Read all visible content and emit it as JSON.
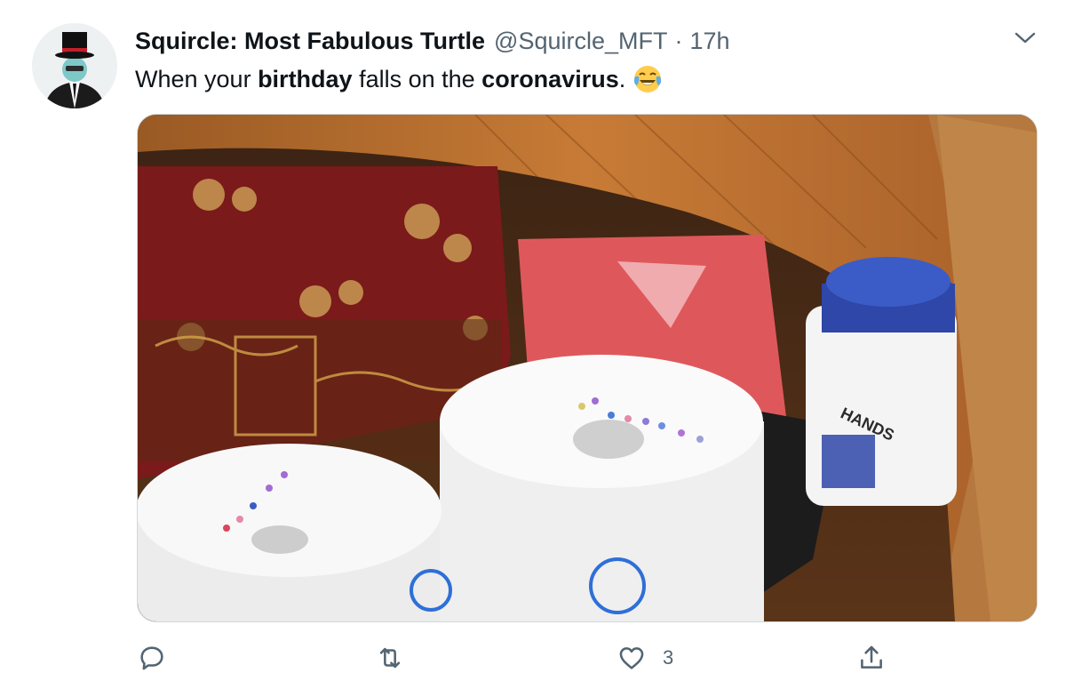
{
  "tweet": {
    "display_name": "Squircle: Most Fabulous Turtle",
    "handle": "@Squircle_MFT",
    "separator": "·",
    "time": "17h",
    "text": {
      "part1": "When your ",
      "bold1": "birthday",
      "part2": " falls on the ",
      "bold2": "coronavirus",
      "part3": "."
    },
    "emoji_icon": "face-with-tears-of-joy-icon",
    "media_icon": "photo"
  },
  "photo_labels": {
    "wipes_label": "HANDS"
  },
  "actions": {
    "reply": {
      "icon": "reply-icon",
      "count": ""
    },
    "retweet": {
      "icon": "retweet-icon",
      "count": ""
    },
    "like": {
      "icon": "heart-icon",
      "count": "3"
    },
    "share": {
      "icon": "share-icon",
      "count": ""
    }
  },
  "colors": {
    "text_primary": "#0f1419",
    "text_secondary": "#536471",
    "border": "#cfd9de"
  }
}
